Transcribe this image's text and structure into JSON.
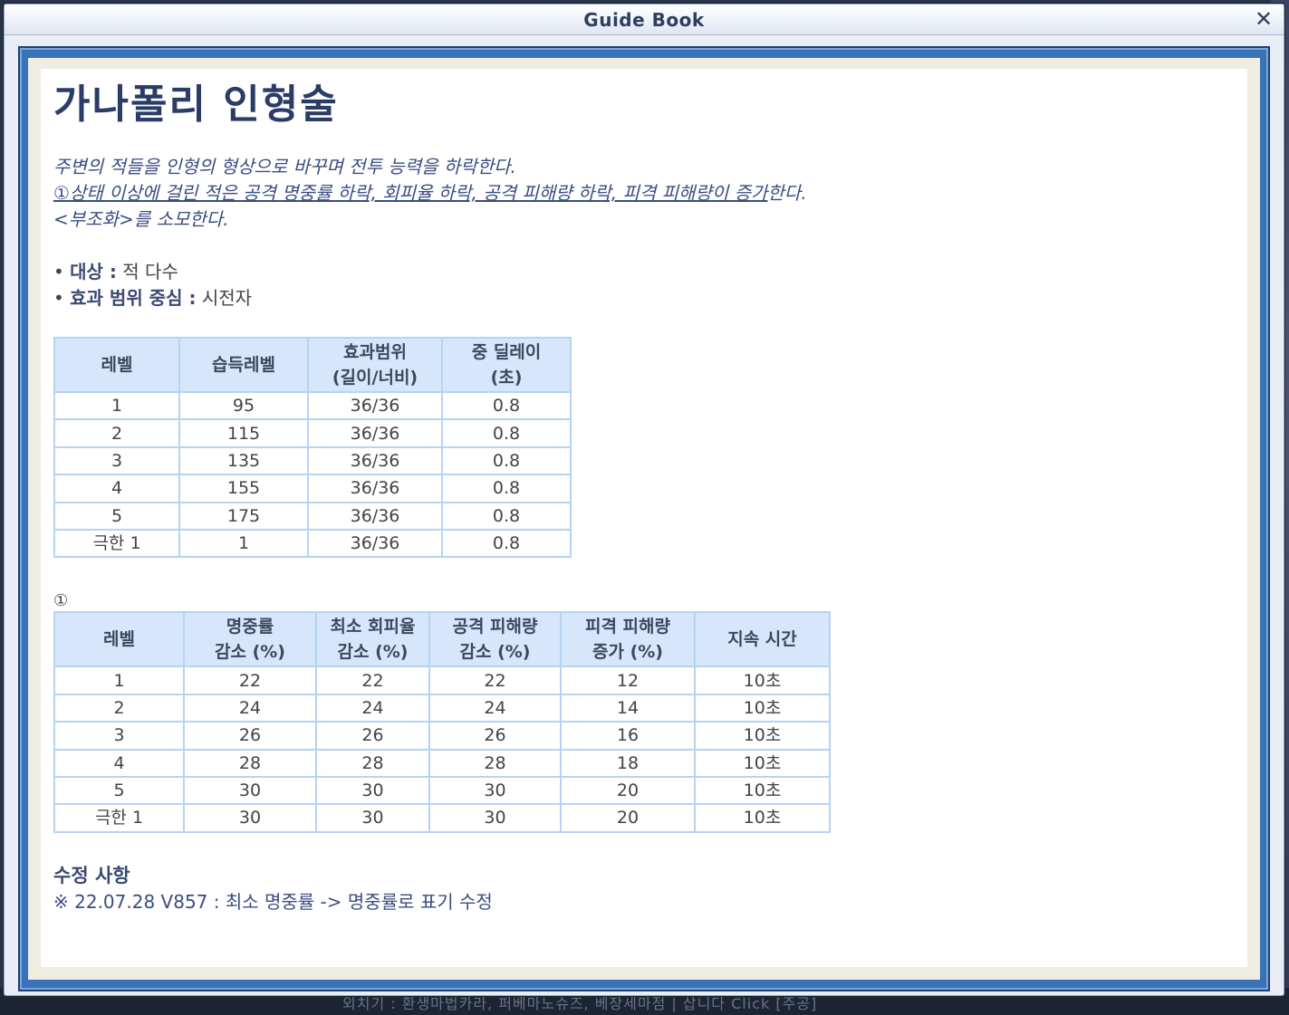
{
  "window": {
    "title": "Guide Book",
    "close_icon": "close-icon"
  },
  "page": {
    "title": "가나폴리 인형술",
    "desc_line1": "주변의 적들을 인형의 형상으로 바꾸며 전투 능력을 하락한다.",
    "desc_line2_underlined": "①상태 이상에 걸린 적은 공격 명중률 하락, 회피율 하락, 공격 피해량 하락, 피격 피해량이 증가",
    "desc_line2_tail": "한다.",
    "desc_line3": "<부조화>를 소모한다.",
    "bullets": [
      {
        "label": "대상 :",
        "value": "적 다수"
      },
      {
        "label": "효과 범위 중심 :",
        "value": "시전자"
      }
    ]
  },
  "table1": {
    "headers": [
      "레벨",
      "습득레벨",
      "효과범위\n(길이/너비)",
      "중 딜레이\n(초)"
    ],
    "rows": [
      [
        "1",
        "95",
        "36/36",
        "0.8"
      ],
      [
        "2",
        "115",
        "36/36",
        "0.8"
      ],
      [
        "3",
        "135",
        "36/36",
        "0.8"
      ],
      [
        "4",
        "155",
        "36/36",
        "0.8"
      ],
      [
        "5",
        "175",
        "36/36",
        "0.8"
      ],
      [
        "극한 1",
        "1",
        "36/36",
        "0.8"
      ]
    ]
  },
  "table2": {
    "label": "①",
    "headers": [
      "레벨",
      "명중률\n감소 (%)",
      "최소 회피율\n감소 (%)",
      "공격 피해량\n감소 (%)",
      "피격 피해량\n증가 (%)",
      "지속 시간"
    ],
    "rows": [
      [
        "1",
        "22",
        "22",
        "22",
        "12",
        "10초"
      ],
      [
        "2",
        "24",
        "24",
        "24",
        "14",
        "10초"
      ],
      [
        "3",
        "26",
        "26",
        "26",
        "16",
        "10초"
      ],
      [
        "4",
        "28",
        "28",
        "28",
        "18",
        "10초"
      ],
      [
        "5",
        "30",
        "30",
        "30",
        "20",
        "10초"
      ],
      [
        "극한 1",
        "30",
        "30",
        "30",
        "20",
        "10초"
      ]
    ]
  },
  "changes": {
    "title": "수정 사항",
    "items": [
      "※ 22.07.28 V857 : 최소 명중률 -> 명중률로 표기 수정"
    ]
  },
  "background": {
    "bottom_text": "외치기 : 환생마법카라, 퍼베마노슈즈, 베장세마점 | 삽니다 Click [주공]"
  }
}
